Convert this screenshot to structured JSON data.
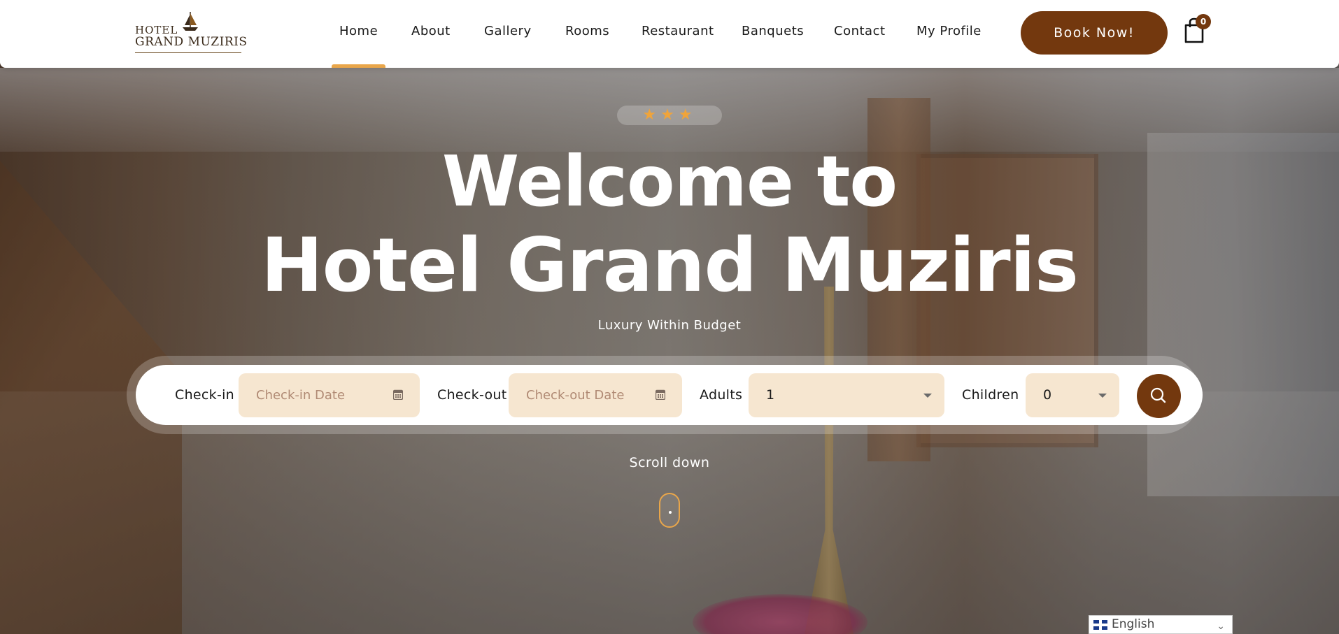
{
  "brand": {
    "logo_line1": "HOTEL",
    "logo_line2": "GRAND MUZIRIS",
    "logo_icon": "ship-icon"
  },
  "nav": {
    "items": [
      {
        "label": "Home",
        "active": true
      },
      {
        "label": "About"
      },
      {
        "label": "Gallery"
      },
      {
        "label": "Rooms"
      },
      {
        "label": "Restaurant"
      },
      {
        "label": "Banquets"
      },
      {
        "label": "Contact"
      },
      {
        "label": "My Profile"
      }
    ],
    "book_label": "Book Now!",
    "cart_icon": "shopping-bag-icon",
    "cart_count": "0"
  },
  "hero": {
    "rating_stars": 3,
    "stars_text": "★★★",
    "title_line1": "Welcome to",
    "title_line2": "Hotel Grand Muziris",
    "tagline": "Luxury Within Budget"
  },
  "booking": {
    "checkin_label": "Check-in",
    "checkin_placeholder": "Check-in Date",
    "checkout_label": "Check-out",
    "checkout_placeholder": "Check-out Date",
    "adults_label": "Adults",
    "adults_value": "1",
    "children_label": "Children",
    "children_value": "0",
    "calendar_icon": "calendar-icon",
    "search_icon": "search-icon"
  },
  "scroll": {
    "label": "Scroll down"
  },
  "language": {
    "selected": "English",
    "flag_icon": "uk-flag-icon"
  },
  "colors": {
    "accent": "#73380e",
    "highlight": "#e9a64a",
    "field_bg": "#f6e6d0",
    "star": "#f0a43a"
  }
}
